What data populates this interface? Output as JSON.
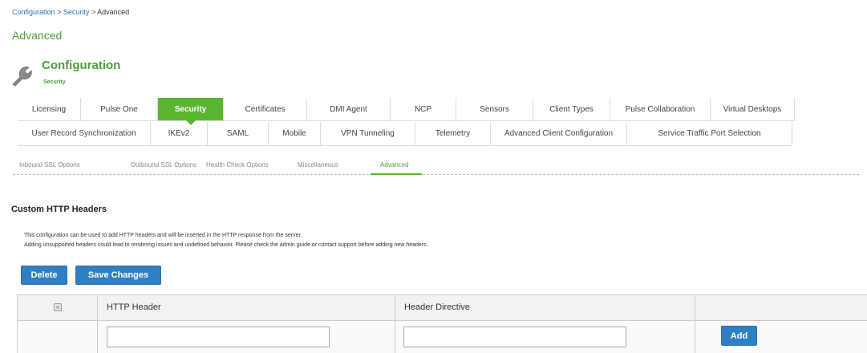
{
  "breadcrumb": {
    "items": [
      "Configuration",
      "Security",
      "Advanced"
    ],
    "separator": ">"
  },
  "page_title": "Advanced",
  "config": {
    "title": "Configuration",
    "subtitle": "Security",
    "icon": "wrench-icon"
  },
  "tabs_row1": [
    {
      "label": "Licensing",
      "active": false
    },
    {
      "label": "Pulse One",
      "active": false
    },
    {
      "label": "Security",
      "active": true
    },
    {
      "label": "Certificates",
      "active": false
    },
    {
      "label": "DMI Agent",
      "active": false
    },
    {
      "label": "NCP",
      "active": false
    },
    {
      "label": "Sensors",
      "active": false
    },
    {
      "label": "Client Types",
      "active": false
    },
    {
      "label": "Pulse Collaboration",
      "active": false
    },
    {
      "label": "Virtual Desktops",
      "active": false
    }
  ],
  "tabs_row2": [
    {
      "label": "User Record Synchronization"
    },
    {
      "label": "IKEv2"
    },
    {
      "label": "SAML"
    },
    {
      "label": "Mobile"
    },
    {
      "label": "VPN Tunneling"
    },
    {
      "label": "Telemetry"
    },
    {
      "label": "Advanced Client Configuration"
    },
    {
      "label": "Service Traffic Port Selection"
    }
  ],
  "subtabs": [
    {
      "label": "Inbound SSL Options",
      "active": false
    },
    {
      "label": "Outbound SSL Options",
      "active": false
    },
    {
      "label": "Health Check Options",
      "active": false
    },
    {
      "label": "Miscellaneous",
      "active": false
    },
    {
      "label": "Advanced",
      "active": true
    }
  ],
  "section": {
    "title": "Custom HTTP Headers",
    "desc_line1": "This configuration can be used to add HTTP headers and will be inserted in the HTTP response from the server.",
    "desc_line2": "Adding unsupported headers could lead to rendering issues and undefined behavior. Please check the admin guide or contact support before adding new headers."
  },
  "buttons": {
    "delete": "Delete",
    "save": "Save Changes",
    "add": "Add"
  },
  "table": {
    "headers": [
      "",
      "HTTP Header",
      "Header Directive",
      ""
    ],
    "new_row": {
      "http_header": "",
      "header_directive": ""
    }
  },
  "colors": {
    "accent_green": "#5cb531",
    "title_green": "#4d9d3a",
    "button_blue": "#2f7fc4",
    "link_blue": "#2a6fb0"
  }
}
